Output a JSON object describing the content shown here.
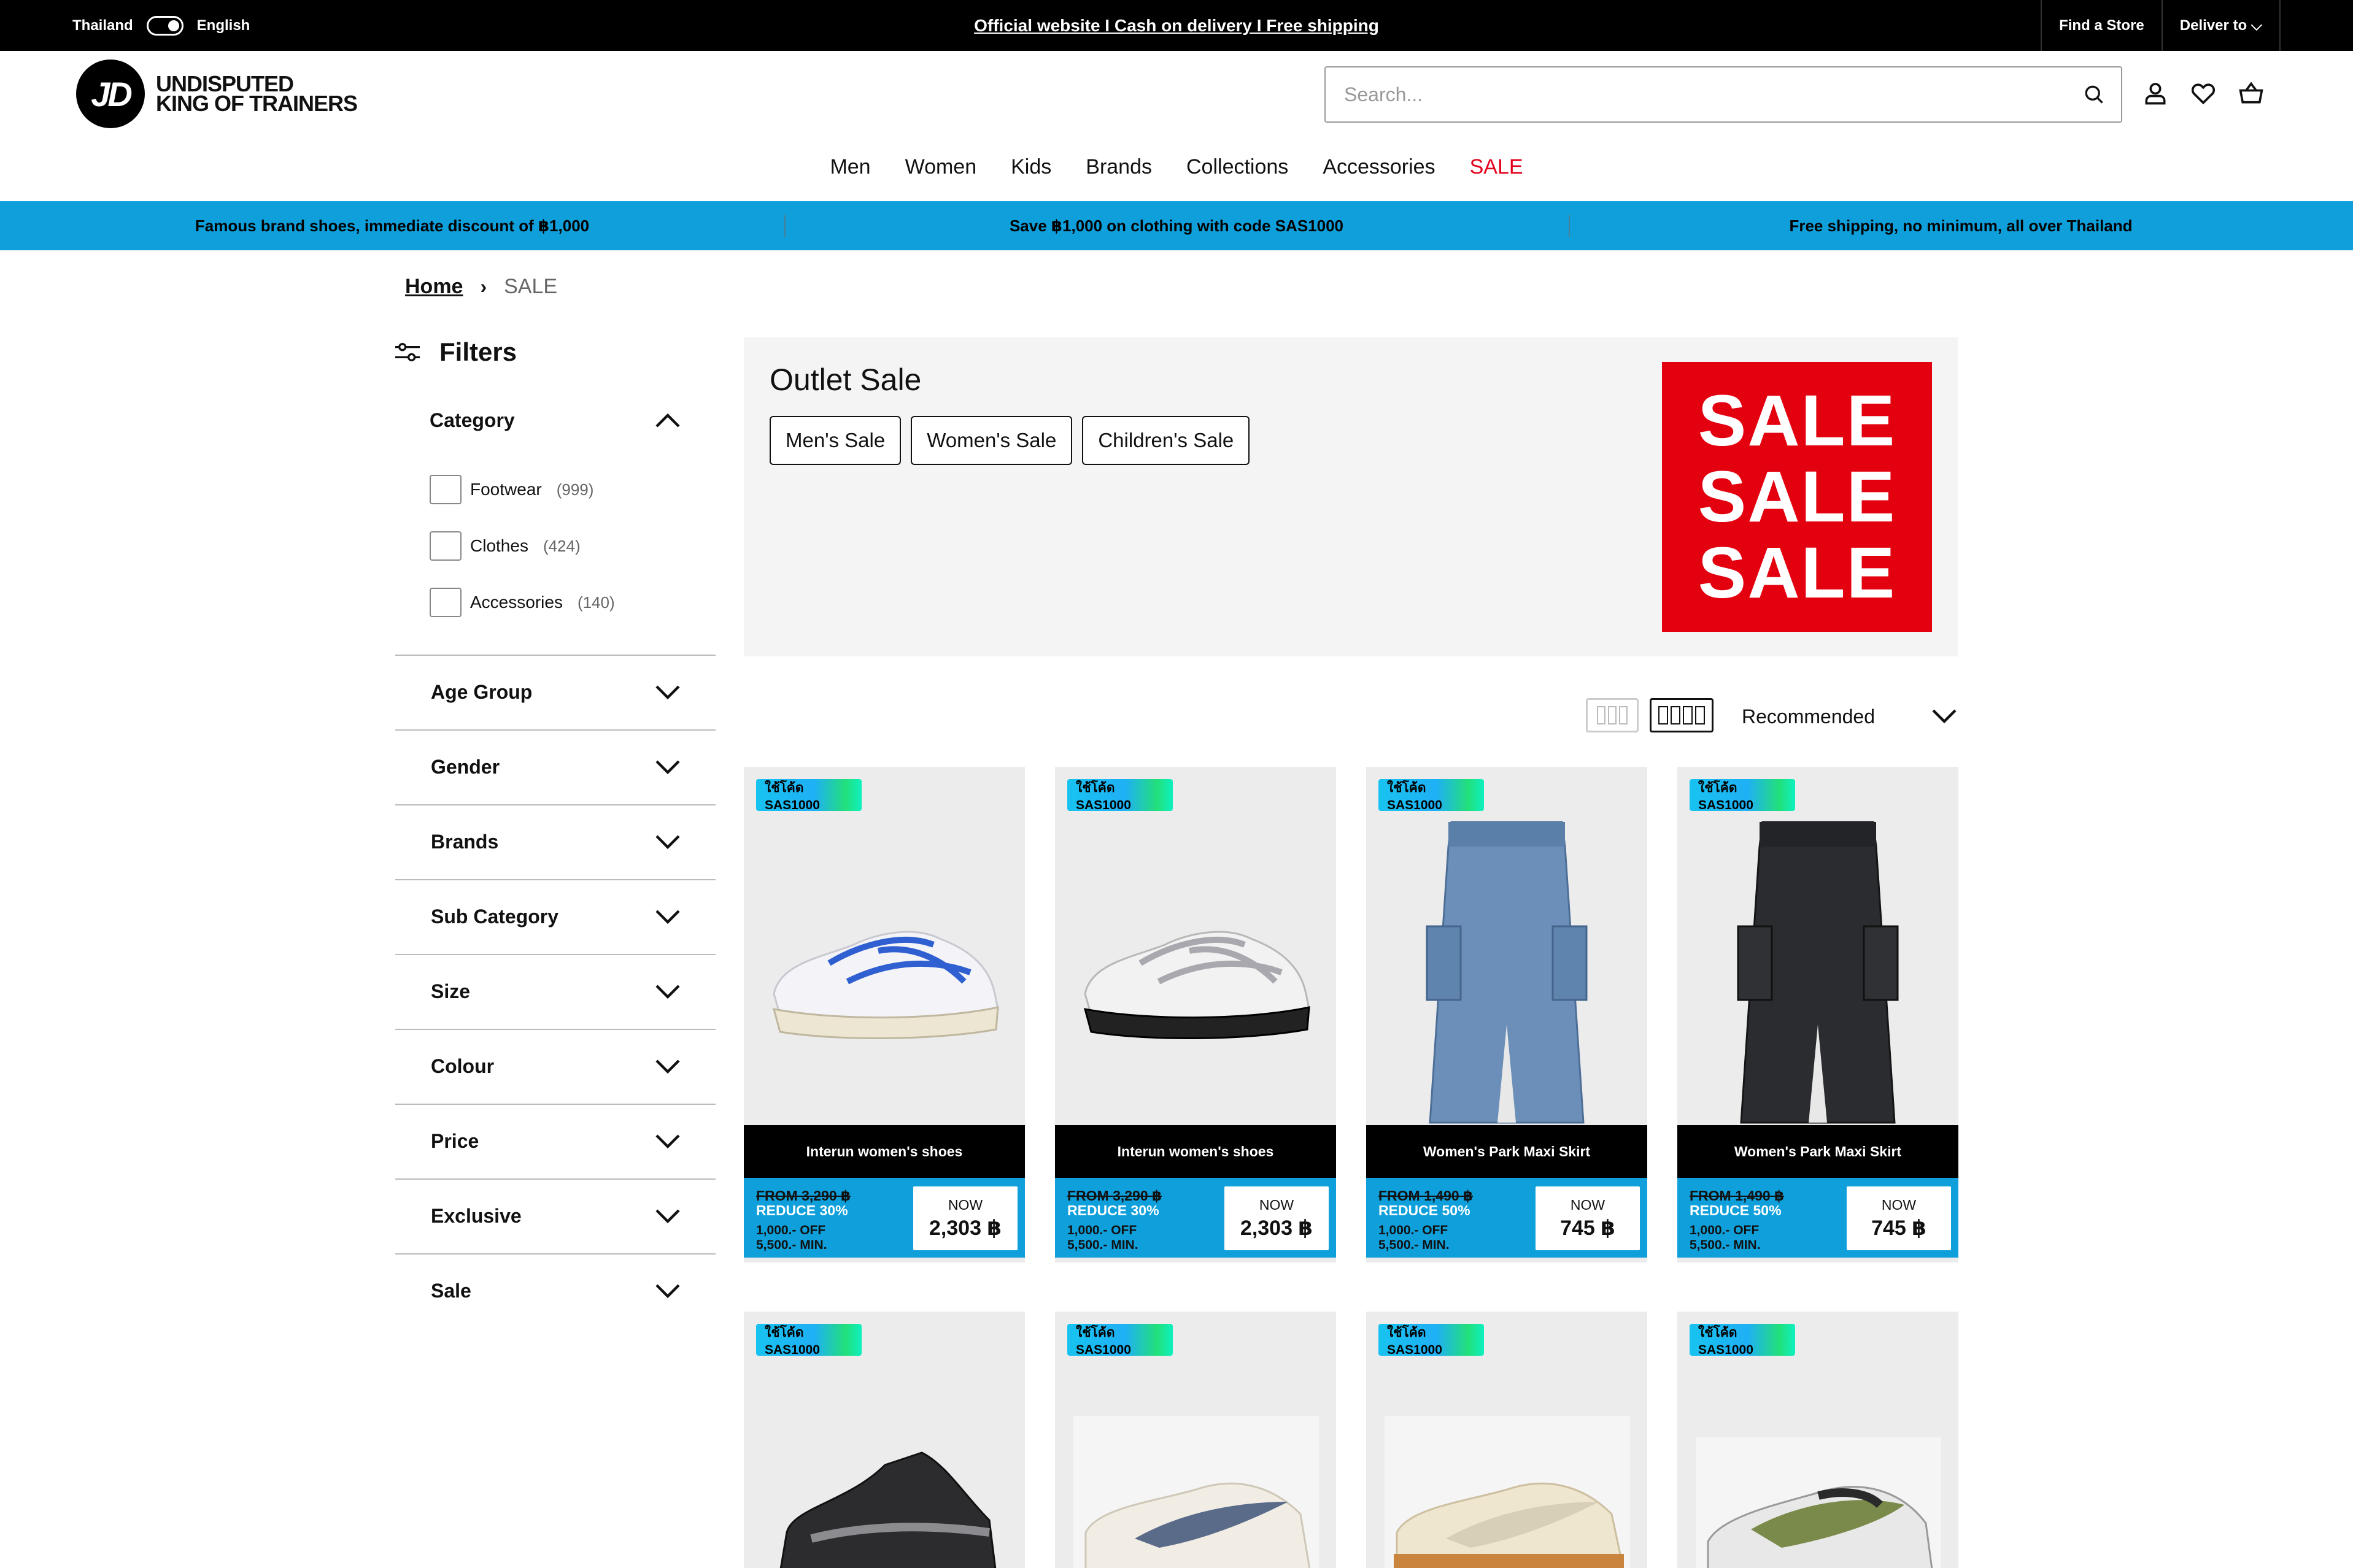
{
  "topbar": {
    "country": "Thailand",
    "language": "English",
    "banner": "Official website I Cash on delivery I Free shipping",
    "find_store": "Find a Store",
    "deliver_to": "Deliver to ⌵"
  },
  "header": {
    "logo_mark": "JD",
    "logo_line1": "UNDISPUTED",
    "logo_line2": "KING OF TRAINERS",
    "search_placeholder": "Search..."
  },
  "nav": [
    "Men",
    "Women",
    "Kids",
    "Brands",
    "Collections",
    "Accessories",
    "SALE"
  ],
  "promos": [
    "Famous brand shoes, immediate discount of ฿1,000",
    "Save ฿1,000 on clothing with code SAS1000",
    "Free shipping, no minimum, all over Thailand"
  ],
  "breadcrumb": {
    "home": "Home",
    "sep": "›",
    "current": "SALE"
  },
  "filters": {
    "title": "Filters",
    "category_label": "Category",
    "category_options": [
      {
        "label": "Footwear",
        "count": "(999)"
      },
      {
        "label": "Clothes",
        "count": "(424)"
      },
      {
        "label": "Accessories",
        "count": "(140)"
      }
    ],
    "groups": [
      "Age Group",
      "Gender",
      "Brands",
      "Sub Category",
      "Size",
      "Colour",
      "Price",
      "Exclusive",
      "Sale"
    ]
  },
  "hero": {
    "title": "Outlet Sale",
    "chips": [
      "Men's Sale",
      "Women's Sale",
      "Children's Sale"
    ],
    "sale_words": [
      "SALE",
      "SALE",
      "SALE"
    ]
  },
  "sort": {
    "label": "Recommended"
  },
  "products": [
    {
      "tag": "ใช้โค้ด SAS1000",
      "name": "Interun women's shoes",
      "was": "FROM 3,290 ฿",
      "reduce": "REDUCE 30%",
      "off1": "1,000.- OFF",
      "off2": "5,500.- MIN.",
      "now_label": "NOW",
      "now": "2,303 ฿",
      "img": "shoe-blue"
    },
    {
      "tag": "ใช้โค้ด SAS1000",
      "name": "Interun women's shoes",
      "was": "FROM 3,290 ฿",
      "reduce": "REDUCE 30%",
      "off1": "1,000.- OFF",
      "off2": "5,500.- MIN.",
      "now_label": "NOW",
      "now": "2,303 ฿",
      "img": "shoe-silver"
    },
    {
      "tag": "ใช้โค้ด SAS1000",
      "name": "Women's Park Maxi Skirt",
      "was": "FROM 1,490 ฿",
      "reduce": "REDUCE 50%",
      "off1": "1,000.- OFF",
      "off2": "5,500.- MIN.",
      "now_label": "NOW",
      "now": "745 ฿",
      "img": "skirt-blue"
    },
    {
      "tag": "ใช้โค้ด SAS1000",
      "name": "Women's Park Maxi Skirt",
      "was": "FROM 1,490 ฿",
      "reduce": "REDUCE 50%",
      "off1": "1,000.- OFF",
      "off2": "5,500.- MIN.",
      "now_label": "NOW",
      "now": "745 ฿",
      "img": "skirt-black"
    },
    {
      "tag": "ใช้โค้ด SAS1000",
      "img": "shoe-black-high"
    },
    {
      "tag": "ใช้โค้ด SAS1000",
      "img": "shoe-killshot-navy"
    },
    {
      "tag": "ใช้โค้ด SAS1000",
      "img": "shoe-killshot-gum"
    },
    {
      "tag": "ใช้โค้ด SAS1000",
      "img": "shoe-airmax-olive"
    }
  ],
  "colors": {
    "accent_blue": "#0fa0dc",
    "sale_red": "#e3001b",
    "topbar": "#000000"
  }
}
